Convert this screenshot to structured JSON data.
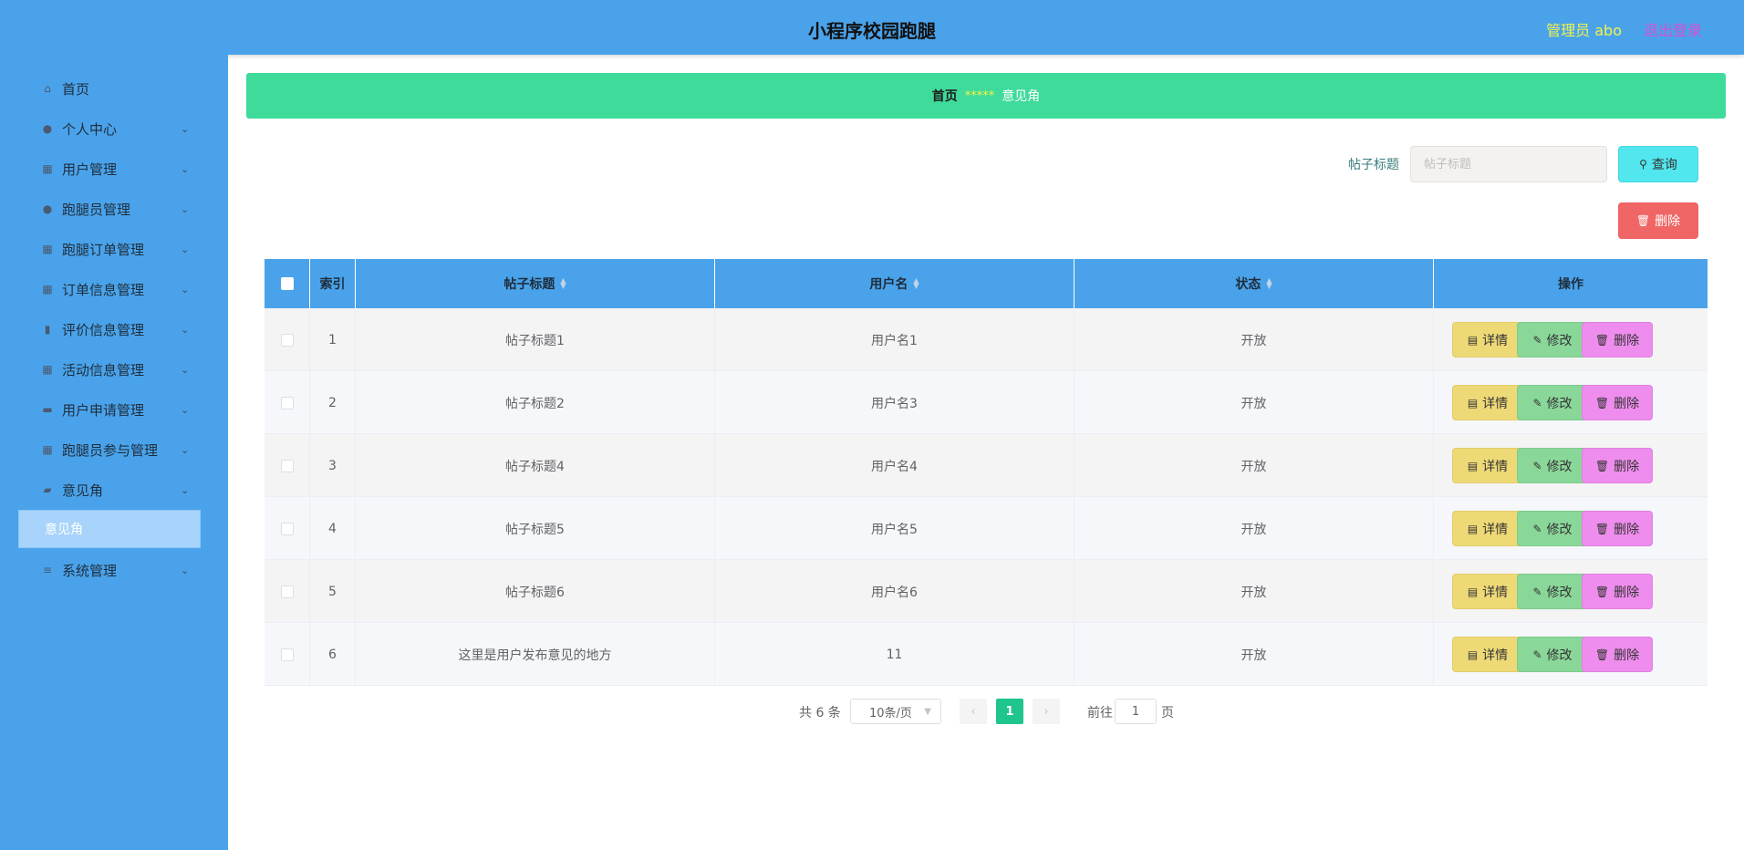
{
  "header": {
    "title": "小程序校园跑腿",
    "admin_label": "管理员 abo",
    "logout_label": "退出登录"
  },
  "sidebar": {
    "items": [
      {
        "label": "首页",
        "icon": "home-icon",
        "has_arrow": false
      },
      {
        "label": "个人中心",
        "icon": "user-icon",
        "has_arrow": true
      },
      {
        "label": "用户管理",
        "icon": "grid-icon",
        "has_arrow": true
      },
      {
        "label": "跑腿员管理",
        "icon": "user-icon",
        "has_arrow": true
      },
      {
        "label": "跑腿订单管理",
        "icon": "grid-icon",
        "has_arrow": true
      },
      {
        "label": "订单信息管理",
        "icon": "grid-icon",
        "has_arrow": true
      },
      {
        "label": "评价信息管理",
        "icon": "chart-icon",
        "has_arrow": true
      },
      {
        "label": "活动信息管理",
        "icon": "grid-icon",
        "has_arrow": true
      },
      {
        "label": "用户申请管理",
        "icon": "comment-icon",
        "has_arrow": true
      },
      {
        "label": "跑腿员参与管理",
        "icon": "grid-icon",
        "has_arrow": true
      },
      {
        "label": "意见角",
        "icon": "ticket-icon",
        "has_arrow": true
      },
      {
        "label": "系统管理",
        "icon": "sliders-icon",
        "has_arrow": true
      }
    ],
    "active_submenu": "意见角"
  },
  "breadcrumb": {
    "home": "首页",
    "separator": "*****",
    "current": "意见角"
  },
  "search": {
    "label": "帖子标题",
    "placeholder": "帖子标题",
    "query_button": "查询",
    "delete_button": "删除"
  },
  "table": {
    "columns": [
      "索引",
      "帖子标题",
      "用户名",
      "状态",
      "操作"
    ],
    "rows": [
      {
        "index": "1",
        "title": "帖子标题1",
        "username": "用户名1",
        "status": "开放"
      },
      {
        "index": "2",
        "title": "帖子标题2",
        "username": "用户名3",
        "status": "开放"
      },
      {
        "index": "3",
        "title": "帖子标题4",
        "username": "用户名4",
        "status": "开放"
      },
      {
        "index": "4",
        "title": "帖子标题5",
        "username": "用户名5",
        "status": "开放"
      },
      {
        "index": "5",
        "title": "帖子标题6",
        "username": "用户名6",
        "status": "开放"
      },
      {
        "index": "6",
        "title": "这里是用户发布意见的地方",
        "username": "11",
        "status": "开放"
      }
    ],
    "actions": {
      "detail": "详情",
      "edit": "修改",
      "delete": "删除"
    }
  },
  "pagination": {
    "total": "共 6 条",
    "page_size": "10条/页",
    "current_page": "1",
    "goto_label": "前往",
    "goto_value": "1",
    "page_unit": "页"
  }
}
